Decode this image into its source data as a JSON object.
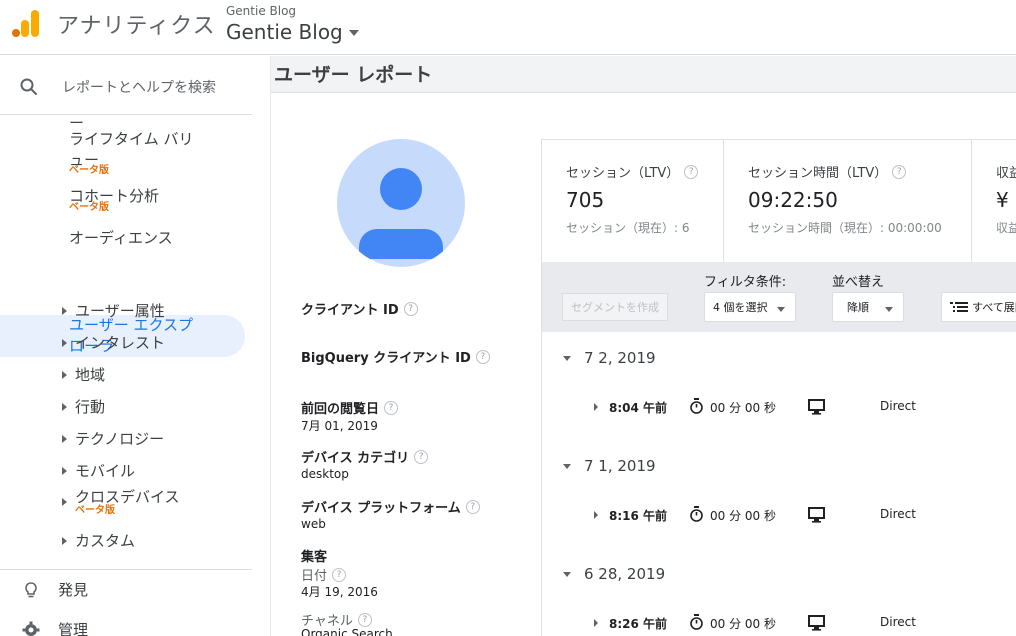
{
  "header": {
    "app_name": "アナリティクス",
    "account_small": "Gentie Blog",
    "account_big": "Gentie Blog"
  },
  "sidebar": {
    "search_placeholder": "レポートとヘルプを検索",
    "partial_item": "ー",
    "items": [
      {
        "label_line1": "ライフタイム バリ",
        "label_line2": "ュー",
        "badge": "ベータ版"
      },
      {
        "label": "コホート分析",
        "badge": "ベータ版"
      },
      {
        "label": "オーディエンス"
      },
      {
        "label_line1": "ユーザー エクスプ",
        "label_line2": "ローラ",
        "active": true
      }
    ],
    "sub_items": [
      {
        "label": "ユーザー属性"
      },
      {
        "label": "インタレスト"
      },
      {
        "label": "地域"
      },
      {
        "label": "行動"
      },
      {
        "label": "テクノロジー"
      },
      {
        "label": "モバイル"
      },
      {
        "label": "クロスデバイス",
        "badge": "ベータ版"
      },
      {
        "label": "カスタム"
      }
    ],
    "bottom_items": [
      {
        "label": "発見",
        "icon": "lightbulb-icon"
      },
      {
        "label": "管理",
        "icon": "gear-icon"
      }
    ]
  },
  "page": {
    "title": "ユーザー レポート"
  },
  "profile": {
    "help_glyph": "?",
    "client_id_label": "クライアント ID",
    "bigquery_label": "BigQuery クライアント ID",
    "last_visit_label": "前回の閲覧日",
    "last_visit_value": "7月 01, 2019",
    "device_category_label": "デバイス カテゴリ",
    "device_category_value": "desktop",
    "device_platform_label": "デバイス プラットフォーム",
    "device_platform_value": "web",
    "acquisition_label": "集客",
    "date_label": "日付",
    "date_value": "4月 19, 2016",
    "channel_label": "チャネル",
    "channel_value": "Organic Search"
  },
  "metrics": [
    {
      "label": "セッション（LTV）",
      "value": "705",
      "sub": "セッション（現在）: 6"
    },
    {
      "label": "セッション時間（LTV）",
      "value": "09:22:50",
      "sub": "セッション時間（現在）: 00:00:00"
    },
    {
      "label": "収益",
      "value": "¥",
      "sub": "収益"
    }
  ],
  "filters": {
    "segment_button": "セグメントを作成",
    "filter_title": "フィルタ条件:",
    "filter_value": "4 個を選択",
    "sort_title": "並べ替え",
    "sort_value": "降順",
    "expand_all": "すべて展開"
  },
  "sessions": [
    {
      "date": "7 2, 2019",
      "time": "8:04 午前",
      "duration": "00 分 00 秒",
      "source": "Direct"
    },
    {
      "date": "7 1, 2019",
      "time": "8:16 午前",
      "duration": "00 分 00 秒",
      "source": "Direct"
    },
    {
      "date": "6 28, 2019",
      "time": "8:26 午前",
      "duration": "00 分 00 秒",
      "source": "Direct"
    }
  ],
  "colors": {
    "accent": "#1a73e8",
    "active_bg": "#e8f0fe",
    "beta": "#e8710a",
    "logo_orange": "#f9ab00",
    "logo_dark": "#e37400",
    "avatar_bg": "#c6dafc",
    "avatar_fg": "#4285f4"
  }
}
